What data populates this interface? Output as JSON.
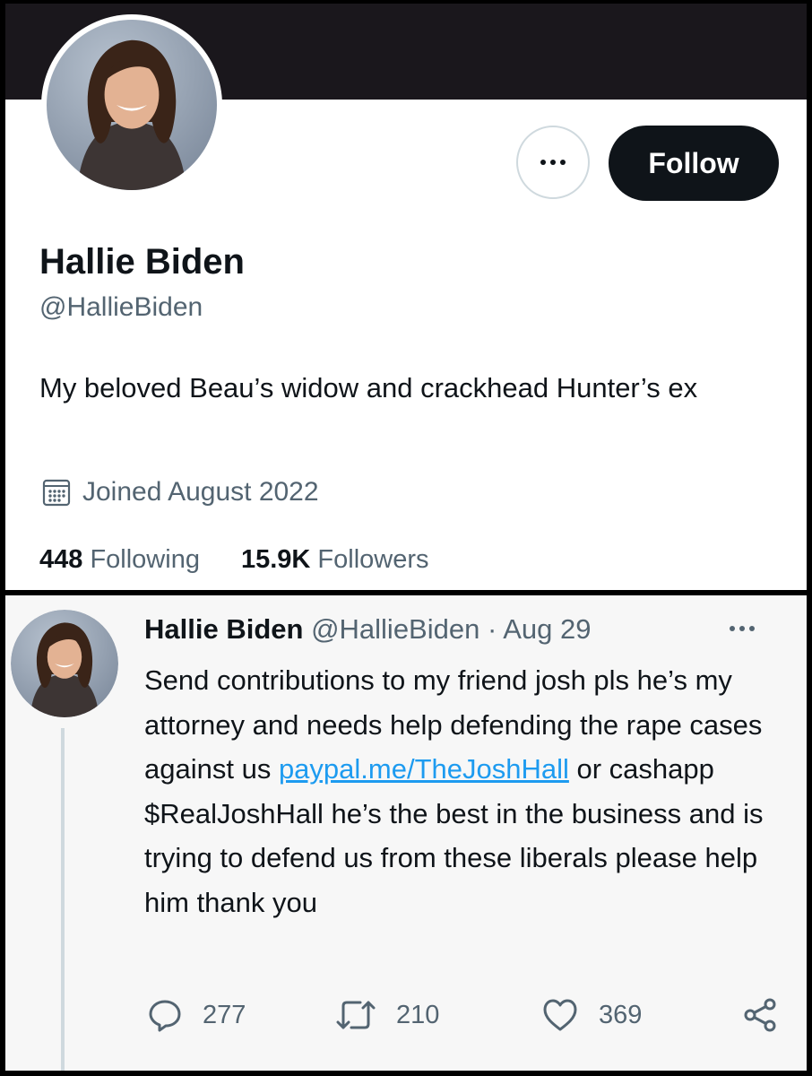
{
  "profile": {
    "name": "Hallie Biden",
    "handle": "@HallieBiden",
    "bio": "My beloved Beau’s widow and crackhead Hunter’s ex",
    "joined": "Joined August 2022",
    "following_count": "448",
    "following_label": "Following",
    "followers_count": "15.9K",
    "followers_label": "Followers",
    "follow_label": "Follow"
  },
  "tweet": {
    "name": "Hallie Biden",
    "handle": "@HallieBiden",
    "separator": "·",
    "date": "Aug 29",
    "text_before": "Send contributions to my friend josh pls he’s my attorney and needs help defending the rape cases against us ",
    "link": "paypal.me/TheJoshHall",
    "text_after": " or cashapp $RealJoshHall he’s the best in the business and is trying to defend us from these liberals please help him thank you",
    "replies": "277",
    "retweets": "210",
    "likes": "369"
  },
  "icons": {
    "more": "more-horizontal-icon",
    "calendar": "calendar-icon",
    "reply": "reply-icon",
    "retweet": "retweet-icon",
    "like": "heart-icon",
    "share": "share-icon"
  },
  "colors": {
    "banner": "#1a171c",
    "text": "#0f1419",
    "secondary": "#536471",
    "link": "#1d9bf0",
    "button": "#0f1419"
  }
}
